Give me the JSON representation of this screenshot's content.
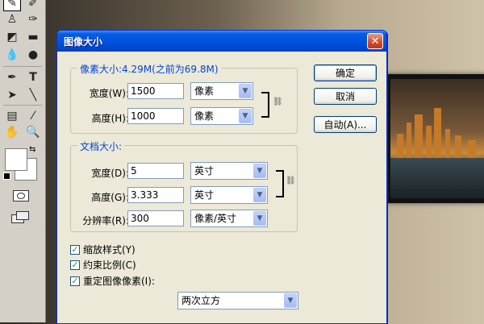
{
  "dialog": {
    "title": "图像大小",
    "close_glyph": "✕"
  },
  "pixel_dimensions": {
    "legend": "像素大小:4.29M(之前为69.8M)",
    "width_label": "宽度(W):",
    "width_value": "1500",
    "width_unit": "像素",
    "height_label": "高度(H):",
    "height_value": "1000",
    "height_unit": "像素"
  },
  "document_size": {
    "legend": "文档大小:",
    "width_label": "宽度(D):",
    "width_value": "5",
    "width_unit": "英寸",
    "height_label": "高度(G):",
    "height_value": "3.333",
    "height_unit": "英寸",
    "resolution_label": "分辨率(R):",
    "resolution_value": "300",
    "resolution_unit": "像素/英寸"
  },
  "buttons": {
    "ok": "确定",
    "cancel": "取消",
    "auto": "自动(A)..."
  },
  "options": {
    "scale_styles": "缩放样式(Y)",
    "constrain_proportions": "约束比例(C)",
    "resample_image": "重定图像像素(I):",
    "resample_method": "两次立方",
    "check_glyph": "✓"
  },
  "toolbox": {
    "text_tool_glyph": "T",
    "swap_glyph": "⇆"
  },
  "colors": {
    "title_bar": "#0054e3",
    "dialog_face": "#ece9d8",
    "legend_text": "#0046d5"
  }
}
